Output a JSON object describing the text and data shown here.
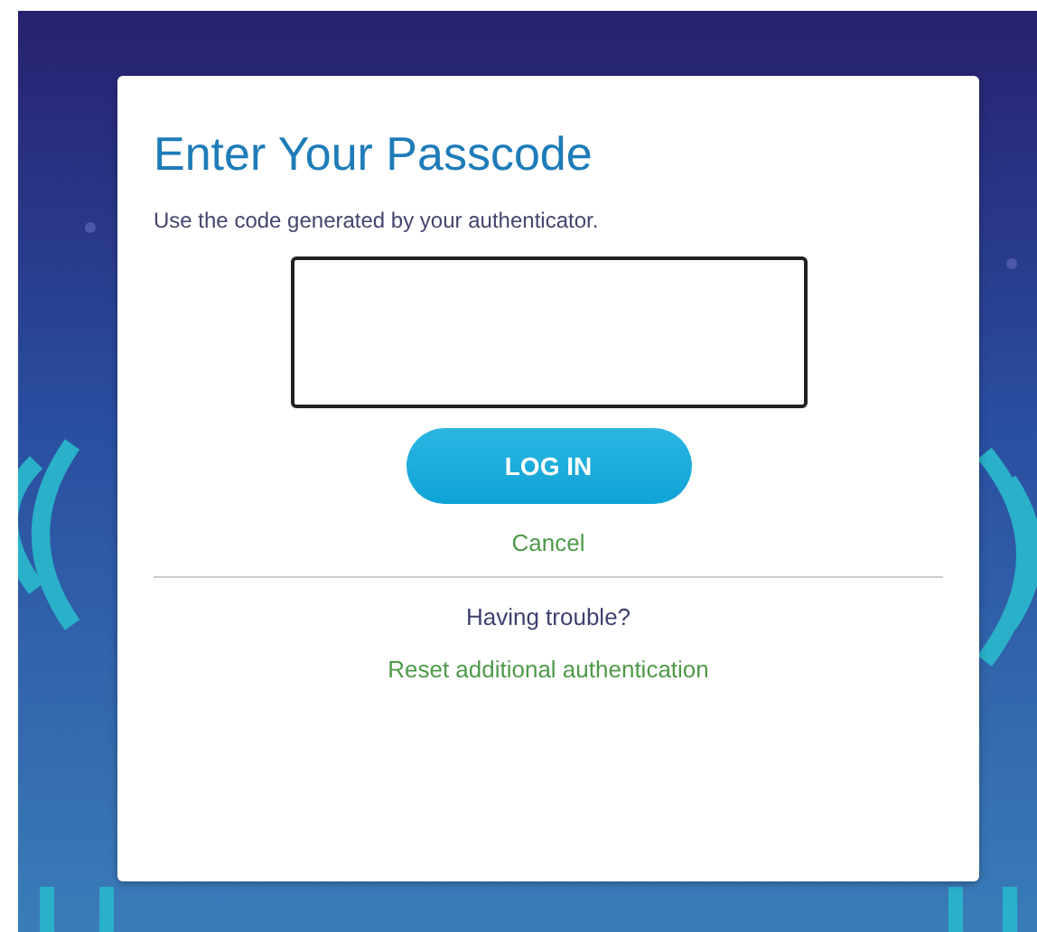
{
  "dialog": {
    "title": "Enter Your Passcode",
    "instruction": "Use the code generated by your authenticator.",
    "login_button": "LOG IN",
    "cancel_link": "Cancel",
    "trouble_text": "Having trouble?",
    "reset_link": "Reset additional authentication"
  }
}
